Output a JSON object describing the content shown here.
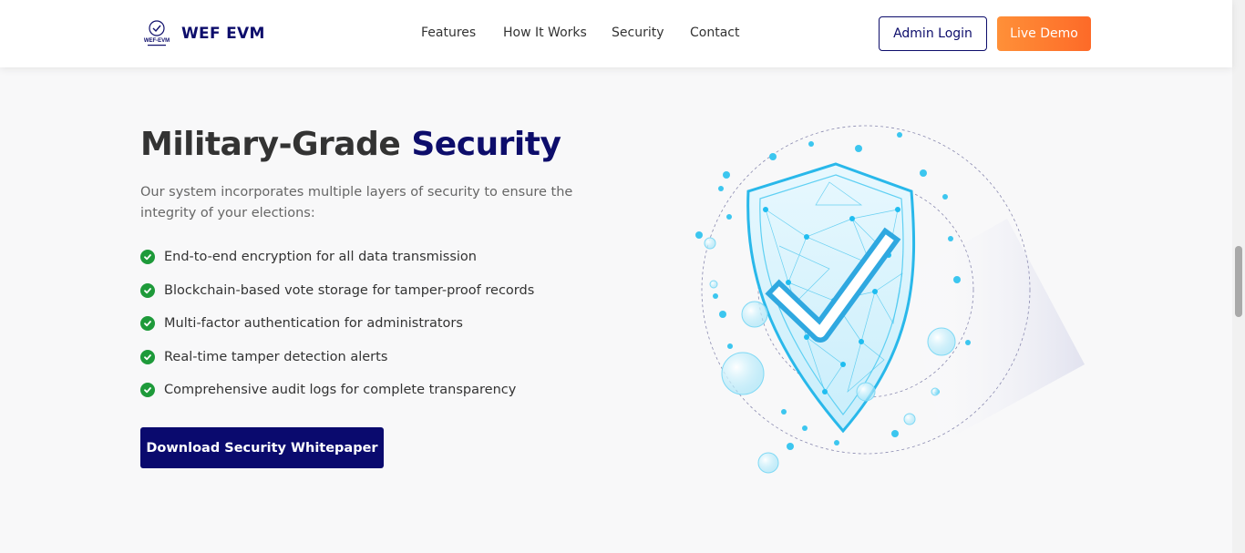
{
  "nav": {
    "brand": "WEF EVM",
    "logo_text": "WEF-EVM",
    "links": [
      "Features",
      "How It Works",
      "Security",
      "Contact"
    ],
    "admin_login": "Admin Login",
    "live_demo": "Live Demo"
  },
  "security": {
    "title_main": "Military-Grade",
    "title_accent": "Security",
    "intro": "Our system incorporates multiple layers of security to ensure the integrity of your elections:",
    "features": [
      "End-to-end encryption for all data transmission",
      "Blockchain-based vote storage for tamper-proof records",
      "Multi-factor authentication for administrators",
      "Real-time tamper detection alerts",
      "Comprehensive audit logs for complete transparency"
    ],
    "cta": "Download Security Whitepaper"
  },
  "icons": {
    "check": "check-circle-icon",
    "shield": "shield-check-icon"
  },
  "colors": {
    "brand_navy": "#0d0d6b",
    "demo_orange": "#fd7a2e",
    "check_green": "#1e9a3a",
    "shield_blue": "#3cc6ef"
  }
}
